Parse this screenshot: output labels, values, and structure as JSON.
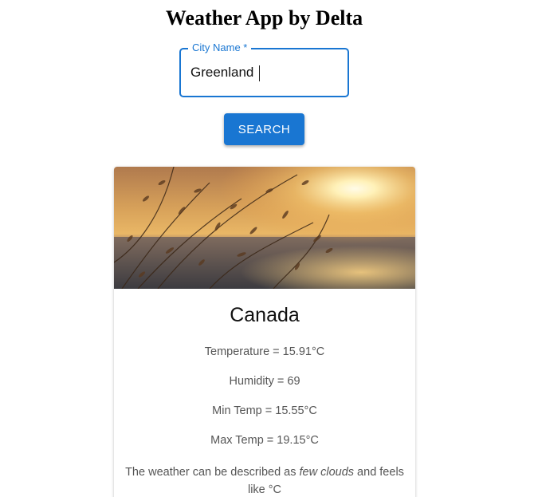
{
  "app": {
    "title": "Weather App by Delta"
  },
  "search": {
    "label": "City Name",
    "required_mark": " *",
    "value": "Greenland",
    "button_label": "SEARCH"
  },
  "weather": {
    "city": "Canada",
    "temperature": "Temperature = 15.91°C",
    "humidity": "Humidity = 69",
    "min_temp": "Min Temp = 15.55°C",
    "max_temp": "Max Temp = 19.15°C",
    "description_prefix": "The weather can be described as ",
    "description": "few clouds",
    "description_suffix": " and feels like °C"
  },
  "theme": {
    "accent": "#1976d2",
    "text_secondary": "#555555"
  }
}
